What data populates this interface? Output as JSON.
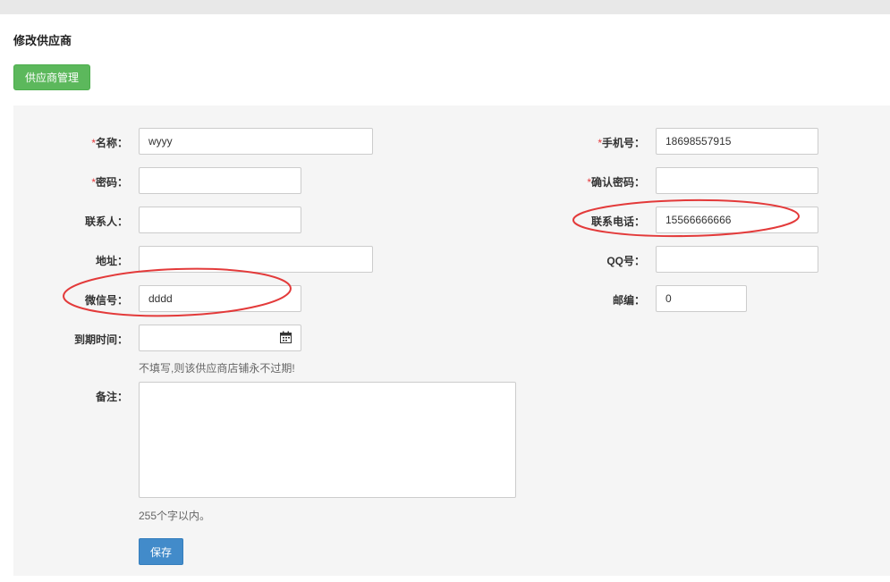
{
  "page": {
    "title": "修改供应商",
    "manage_button": "供应商管理"
  },
  "form": {
    "required_mark": "*",
    "name": {
      "label": "名称：",
      "value": "wyyy"
    },
    "password": {
      "label": "密码：",
      "value": ""
    },
    "contact": {
      "label": "联系人：",
      "value": ""
    },
    "address": {
      "label": "地址：",
      "value": ""
    },
    "wechat": {
      "label": "微信号：",
      "value": "dddd"
    },
    "expire": {
      "label": "到期时间：",
      "value": "",
      "hint": "不填写,则该供应商店铺永不过期!"
    },
    "remark": {
      "label": "备注：",
      "value": "",
      "hint": "255个字以内。"
    },
    "mobile": {
      "label": "手机号：",
      "value": "18698557915"
    },
    "confirm_password": {
      "label": "确认密码：",
      "value": ""
    },
    "phone": {
      "label": "联系电话：",
      "value": "15566666666"
    },
    "qq": {
      "label": "QQ号：",
      "value": ""
    },
    "zipcode": {
      "label": "邮编：",
      "value": "0"
    },
    "save_button": "保存"
  },
  "colors": {
    "manage_button": "#5cb85c",
    "save_button": "#428bca",
    "required": "#e4393c",
    "annotation": "#e33a3a",
    "panel": "#f5f5f5"
  },
  "icons": {
    "calendar": "calendar-icon"
  }
}
